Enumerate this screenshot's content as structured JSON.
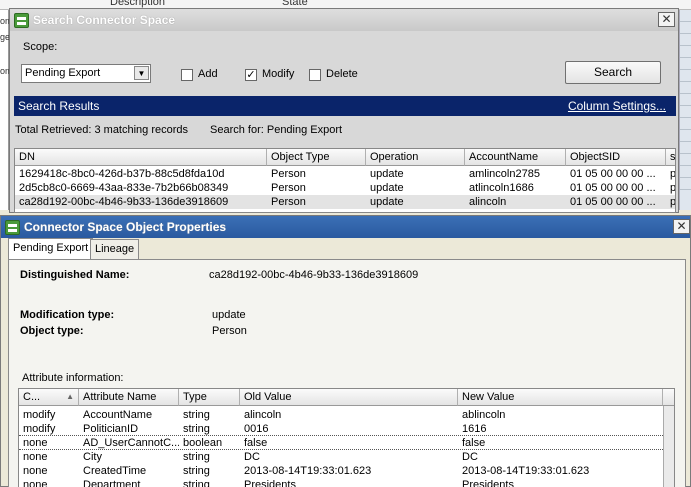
{
  "background": {
    "col_description": "Description",
    "col_state": "State",
    "left_fragments": [
      "om",
      "ge",
      "",
      "om"
    ]
  },
  "search_dialog": {
    "title": "Search Connector Space",
    "scope_label": "Scope:",
    "scope_value": "Pending Export",
    "add_label": "Add",
    "add_checked": "",
    "modify_label": "Modify",
    "modify_checked": "✓",
    "delete_label": "Delete",
    "delete_checked": "",
    "search_button": "Search",
    "results_title": "Search Results",
    "column_settings": "Column Settings...",
    "total_retrieved": "Total Retrieved: 3 matching records",
    "search_for": "Search for: Pending Export",
    "columns": [
      "DN",
      "Object Type",
      "Operation",
      "AccountName",
      "ObjectSID",
      "s"
    ],
    "rows": [
      [
        "1629418c-8bc0-426d-b37b-88c5d8fda10d",
        "Person",
        "update",
        "amlincoln2785",
        "01 05 00 00 00 ...",
        "p"
      ],
      [
        "2d5cb8c0-6669-43aa-833e-7b2b66b08349",
        "Person",
        "update",
        "atlincoln1686",
        "01 05 00 00 00 ...",
        "p"
      ],
      [
        "ca28d192-00bc-4b46-9b33-136de3918609",
        "Person",
        "update",
        "alincoln",
        "01 05 00 00 00 ...",
        "p"
      ]
    ]
  },
  "properties_dialog": {
    "title": "Connector Space Object Properties",
    "tabs": [
      "Pending Export",
      "Lineage"
    ],
    "dn_label": "Distinguished Name:",
    "dn_value": "ca28d192-00bc-4b46-9b33-136de3918609",
    "mod_type_label": "Modification type:",
    "mod_type_value": "update",
    "obj_type_label": "Object type:",
    "obj_type_value": "Person",
    "attr_info_label": "Attribute information:",
    "attr_columns": [
      "C...",
      "Attribute Name",
      "Type",
      "Old Value",
      "New Value"
    ],
    "attr_rows": [
      [
        "modify",
        "AccountName",
        "string",
        "alincoln",
        "ablincoln"
      ],
      [
        "modify",
        "PoliticianID",
        "string",
        "0016",
        "1616"
      ],
      [
        "none",
        "AD_UserCannotC...",
        "boolean",
        "false",
        "false"
      ],
      [
        "none",
        "City",
        "string",
        "DC",
        "DC"
      ],
      [
        "none",
        "CreatedTime",
        "string",
        "2013-08-14T19:33:01.623",
        "2013-08-14T19:33:01.623"
      ],
      [
        "none",
        "Department",
        "string",
        "Presidents",
        "Presidents"
      ]
    ]
  }
}
